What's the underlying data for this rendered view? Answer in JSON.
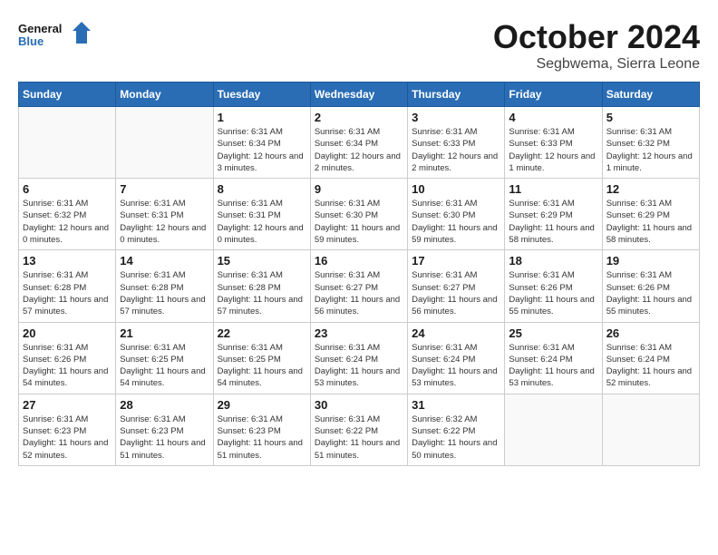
{
  "logo": {
    "line1": "General",
    "line2": "Blue"
  },
  "title": "October 2024",
  "location": "Segbwema, Sierra Leone",
  "days_of_week": [
    "Sunday",
    "Monday",
    "Tuesday",
    "Wednesday",
    "Thursday",
    "Friday",
    "Saturday"
  ],
  "weeks": [
    [
      {
        "day": "",
        "info": ""
      },
      {
        "day": "",
        "info": ""
      },
      {
        "day": "1",
        "info": "Sunrise: 6:31 AM\nSunset: 6:34 PM\nDaylight: 12 hours and 3 minutes."
      },
      {
        "day": "2",
        "info": "Sunrise: 6:31 AM\nSunset: 6:34 PM\nDaylight: 12 hours and 2 minutes."
      },
      {
        "day": "3",
        "info": "Sunrise: 6:31 AM\nSunset: 6:33 PM\nDaylight: 12 hours and 2 minutes."
      },
      {
        "day": "4",
        "info": "Sunrise: 6:31 AM\nSunset: 6:33 PM\nDaylight: 12 hours and 1 minute."
      },
      {
        "day": "5",
        "info": "Sunrise: 6:31 AM\nSunset: 6:32 PM\nDaylight: 12 hours and 1 minute."
      }
    ],
    [
      {
        "day": "6",
        "info": "Sunrise: 6:31 AM\nSunset: 6:32 PM\nDaylight: 12 hours and 0 minutes."
      },
      {
        "day": "7",
        "info": "Sunrise: 6:31 AM\nSunset: 6:31 PM\nDaylight: 12 hours and 0 minutes."
      },
      {
        "day": "8",
        "info": "Sunrise: 6:31 AM\nSunset: 6:31 PM\nDaylight: 12 hours and 0 minutes."
      },
      {
        "day": "9",
        "info": "Sunrise: 6:31 AM\nSunset: 6:30 PM\nDaylight: 11 hours and 59 minutes."
      },
      {
        "day": "10",
        "info": "Sunrise: 6:31 AM\nSunset: 6:30 PM\nDaylight: 11 hours and 59 minutes."
      },
      {
        "day": "11",
        "info": "Sunrise: 6:31 AM\nSunset: 6:29 PM\nDaylight: 11 hours and 58 minutes."
      },
      {
        "day": "12",
        "info": "Sunrise: 6:31 AM\nSunset: 6:29 PM\nDaylight: 11 hours and 58 minutes."
      }
    ],
    [
      {
        "day": "13",
        "info": "Sunrise: 6:31 AM\nSunset: 6:28 PM\nDaylight: 11 hours and 57 minutes."
      },
      {
        "day": "14",
        "info": "Sunrise: 6:31 AM\nSunset: 6:28 PM\nDaylight: 11 hours and 57 minutes."
      },
      {
        "day": "15",
        "info": "Sunrise: 6:31 AM\nSunset: 6:28 PM\nDaylight: 11 hours and 57 minutes."
      },
      {
        "day": "16",
        "info": "Sunrise: 6:31 AM\nSunset: 6:27 PM\nDaylight: 11 hours and 56 minutes."
      },
      {
        "day": "17",
        "info": "Sunrise: 6:31 AM\nSunset: 6:27 PM\nDaylight: 11 hours and 56 minutes."
      },
      {
        "day": "18",
        "info": "Sunrise: 6:31 AM\nSunset: 6:26 PM\nDaylight: 11 hours and 55 minutes."
      },
      {
        "day": "19",
        "info": "Sunrise: 6:31 AM\nSunset: 6:26 PM\nDaylight: 11 hours and 55 minutes."
      }
    ],
    [
      {
        "day": "20",
        "info": "Sunrise: 6:31 AM\nSunset: 6:26 PM\nDaylight: 11 hours and 54 minutes."
      },
      {
        "day": "21",
        "info": "Sunrise: 6:31 AM\nSunset: 6:25 PM\nDaylight: 11 hours and 54 minutes."
      },
      {
        "day": "22",
        "info": "Sunrise: 6:31 AM\nSunset: 6:25 PM\nDaylight: 11 hours and 54 minutes."
      },
      {
        "day": "23",
        "info": "Sunrise: 6:31 AM\nSunset: 6:24 PM\nDaylight: 11 hours and 53 minutes."
      },
      {
        "day": "24",
        "info": "Sunrise: 6:31 AM\nSunset: 6:24 PM\nDaylight: 11 hours and 53 minutes."
      },
      {
        "day": "25",
        "info": "Sunrise: 6:31 AM\nSunset: 6:24 PM\nDaylight: 11 hours and 53 minutes."
      },
      {
        "day": "26",
        "info": "Sunrise: 6:31 AM\nSunset: 6:24 PM\nDaylight: 11 hours and 52 minutes."
      }
    ],
    [
      {
        "day": "27",
        "info": "Sunrise: 6:31 AM\nSunset: 6:23 PM\nDaylight: 11 hours and 52 minutes."
      },
      {
        "day": "28",
        "info": "Sunrise: 6:31 AM\nSunset: 6:23 PM\nDaylight: 11 hours and 51 minutes."
      },
      {
        "day": "29",
        "info": "Sunrise: 6:31 AM\nSunset: 6:23 PM\nDaylight: 11 hours and 51 minutes."
      },
      {
        "day": "30",
        "info": "Sunrise: 6:31 AM\nSunset: 6:22 PM\nDaylight: 11 hours and 51 minutes."
      },
      {
        "day": "31",
        "info": "Sunrise: 6:32 AM\nSunset: 6:22 PM\nDaylight: 11 hours and 50 minutes."
      },
      {
        "day": "",
        "info": ""
      },
      {
        "day": "",
        "info": ""
      }
    ]
  ]
}
